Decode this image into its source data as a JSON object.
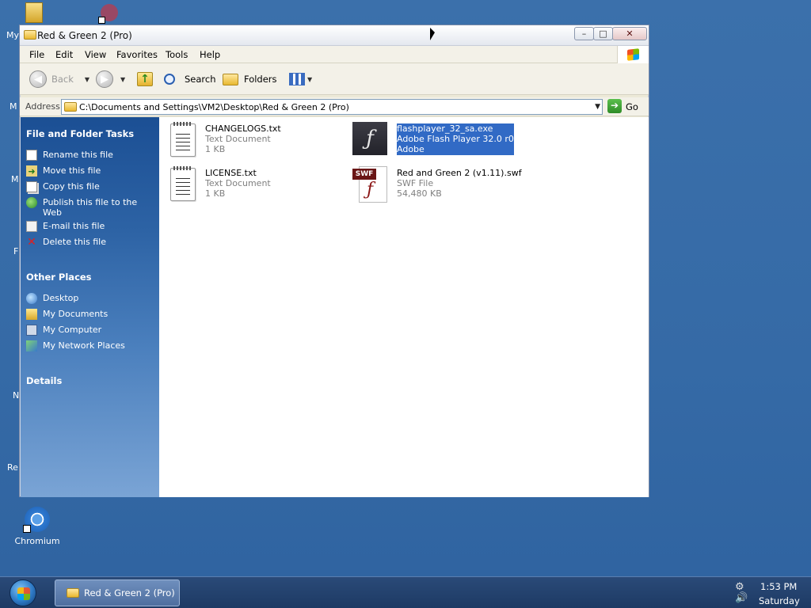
{
  "desktop": {
    "icons": {
      "my_documents_partial": "My",
      "chromium": "Chromium",
      "partial_m1": "M",
      "partial_m2": "M",
      "partial_f": "F",
      "partial_n": "N",
      "partial_re": "Re"
    }
  },
  "window": {
    "title": "Red & Green 2 (Pro)",
    "caption_buttons": {
      "minimize": "–",
      "maximize": "□",
      "close": "✕"
    }
  },
  "menubar": {
    "items": [
      "File",
      "Edit",
      "View",
      "Favorites",
      "Tools",
      "Help"
    ]
  },
  "toolbar": {
    "back_label": "Back",
    "search_label": "Search",
    "folders_label": "Folders"
  },
  "address": {
    "label": "Address",
    "value": "C:\\Documents and Settings\\VM2\\Desktop\\Red & Green 2 (Pro)",
    "go_label": "Go"
  },
  "taskpane": {
    "file_tasks_title": "File and Folder Tasks",
    "file_tasks": [
      "Rename this file",
      "Move this file",
      "Copy this file",
      "Publish this file to the Web",
      "E-mail this file",
      "Delete this file"
    ],
    "other_places_title": "Other Places",
    "other_places": [
      "Desktop",
      "My Documents",
      "My Computer",
      "My Network Places"
    ],
    "details_title": "Details"
  },
  "files": [
    {
      "name": "CHANGELOGS.txt",
      "type": "Text Document",
      "size": "1 KB",
      "icon": "text-document-icon"
    },
    {
      "name": "flashplayer_32_sa.exe",
      "type": "Adobe Flash Player 32.0 r0",
      "size": "Adobe",
      "icon": "flash-player-icon",
      "selected": true
    },
    {
      "name": "LICENSE.txt",
      "type": "Text Document",
      "size": "1 KB",
      "icon": "text-document-icon"
    },
    {
      "name": "Red and Green 2 (v1.11).swf",
      "type": "SWF File",
      "size": "54,480 KB",
      "icon": "swf-file-icon",
      "badge": "SWF"
    }
  ],
  "taskbar": {
    "task_label": "Red & Green 2 (Pro)",
    "time": "1:53 PM",
    "day": "Saturday"
  },
  "colors": {
    "desktop_bg": "#3a6ea5",
    "selection": "#316ac5",
    "taskpane_top": "#1b4f94"
  }
}
